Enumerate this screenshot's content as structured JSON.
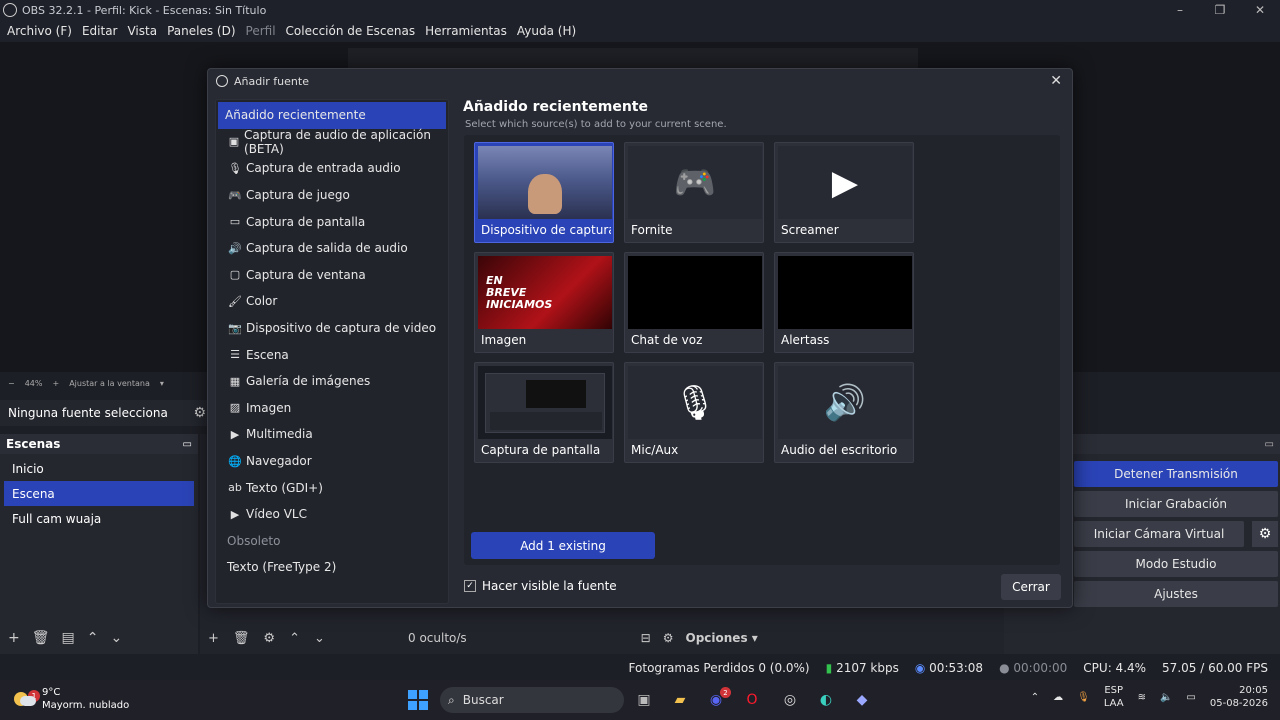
{
  "window": {
    "title": "OBS 32.2.1 - Perfil: Kick - Escenas: Sin Título",
    "controls": [
      "–",
      "❐",
      "✕"
    ]
  },
  "menu": [
    {
      "label": "Archivo (F)",
      "enabled": true
    },
    {
      "label": "Editar",
      "enabled": true
    },
    {
      "label": "Vista",
      "enabled": true
    },
    {
      "label": "Paneles (D)",
      "enabled": true
    },
    {
      "label": "Perfil",
      "enabled": false
    },
    {
      "label": "Colección de Escenas",
      "enabled": true
    },
    {
      "label": "Herramientas",
      "enabled": true
    },
    {
      "label": "Ayuda (H)",
      "enabled": true
    }
  ],
  "preview": {
    "zoom": "44%",
    "fit_label": "Ajustar a la ventana"
  },
  "sources_panel": {
    "no_source_label": "Ninguna fuente selecciona"
  },
  "scenes_panel": {
    "title": "Escenas",
    "items": [
      "Inicio",
      "Escena",
      "Full cam wuaja"
    ],
    "active_index": 1
  },
  "mixer": {
    "hidden_label": "0 oculto/s",
    "options_label": "Opciones"
  },
  "controls": {
    "stop_stream": "Detener Transmisión",
    "start_recording": "Iniciar Grabación",
    "start_virtual_cam": "Iniciar Cámara Virtual",
    "studio_mode": "Modo Estudio",
    "settings": "Ajustes"
  },
  "status": {
    "dropped_frames": "Fotogramas Perdidos 0 (0.0%)",
    "bitrate": "2107 kbps",
    "stream_time": "00:53:08",
    "record_time": "00:00:00",
    "cpu": "CPU: 4.4%",
    "fps": "57.05 / 60.00 FPS"
  },
  "dialog": {
    "title": "Añadir fuente",
    "source_types": [
      {
        "label": "Añadido recientemente",
        "icon": "none",
        "active": true
      },
      {
        "label": "Captura de audio de aplicación (BETA)",
        "icon": "app-audio-icon"
      },
      {
        "label": "Captura de entrada audio",
        "icon": "microphone-icon"
      },
      {
        "label": "Captura de juego",
        "icon": "gamepad-icon"
      },
      {
        "label": "Captura de pantalla",
        "icon": "monitor-icon"
      },
      {
        "label": "Captura de salida de audio",
        "icon": "speaker-icon"
      },
      {
        "label": "Captura de ventana",
        "icon": "window-icon"
      },
      {
        "label": "Color",
        "icon": "brush-icon"
      },
      {
        "label": "Dispositivo de captura de video",
        "icon": "camera-icon"
      },
      {
        "label": "Escena",
        "icon": "list-icon"
      },
      {
        "label": "Galería de imágenes",
        "icon": "gallery-icon"
      },
      {
        "label": "Imagen",
        "icon": "image-icon"
      },
      {
        "label": "Multimedia",
        "icon": "play-icon"
      },
      {
        "label": "Navegador",
        "icon": "globe-icon"
      },
      {
        "label": "Texto (GDI+)",
        "icon": "text-icon"
      },
      {
        "label": "Vídeo VLC",
        "icon": "play-icon"
      },
      {
        "label": "Obsoleto",
        "icon": "none",
        "category": true
      },
      {
        "label": "Texto (FreeType 2)",
        "icon": "none"
      }
    ],
    "heading": "Añadido recientemente",
    "subheading": "Select which source(s) to add to your current scene.",
    "tiles": [
      {
        "label": "Dispositivo de captura de",
        "thumb": "webcam",
        "active": true
      },
      {
        "label": "Fornite",
        "thumb": "gamepad-icon"
      },
      {
        "label": "Screamer",
        "thumb": "play-icon"
      },
      {
        "label": "Imagen",
        "thumb": "banner"
      },
      {
        "label": "Chat de voz",
        "thumb": "black"
      },
      {
        "label": "Alertass",
        "thumb": "black"
      },
      {
        "label": "Captura de pantalla",
        "thumb": "screen"
      },
      {
        "label": "Mic/Aux",
        "thumb": "microphone-icon"
      },
      {
        "label": "Audio del escritorio",
        "thumb": "speaker-icon"
      }
    ],
    "banner_text": "EN BREVE INICIAMOS",
    "add_button": "Add 1 existing",
    "visible_checkbox": {
      "label": "Hacer visible la fuente",
      "checked": true
    },
    "close_button": "Cerrar"
  },
  "taskbar": {
    "weather_temp": "9°C",
    "weather_desc": "Mayorm. nublado",
    "weather_badge": "1",
    "search_placeholder": "Buscar",
    "discord_badge": "2",
    "lang_line1": "ESP",
    "lang_line2": "LAA",
    "time": "20:05",
    "date": "05-08-2026"
  }
}
